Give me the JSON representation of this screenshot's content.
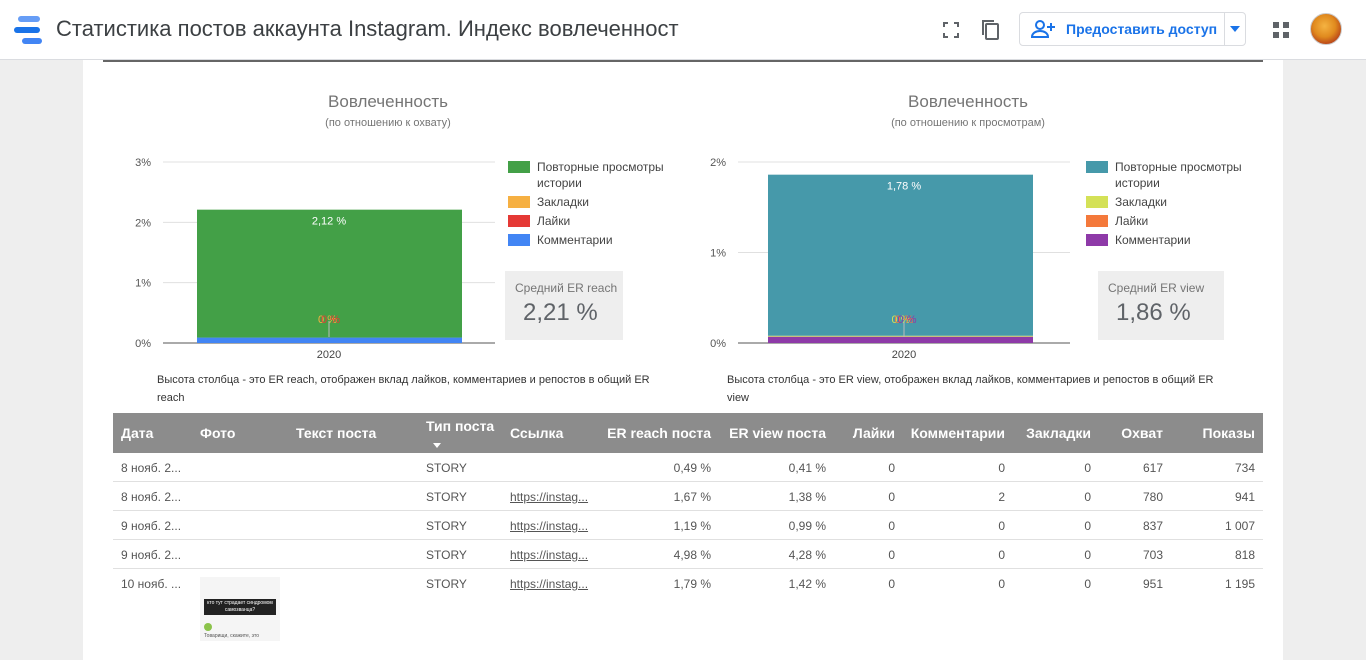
{
  "app": {
    "title": "Статистика постов аккаунта Instagram. Индекс вовлеченност",
    "share_label": "Предоставить доступ"
  },
  "icons": {
    "logo": "data-studio-logo-icon",
    "fullscreen": "fullscreen-icon",
    "copy": "copy-icon",
    "share": "add-person-icon",
    "apps": "apps-grid-icon"
  },
  "charts": {
    "left": {
      "title": "Вовлеченность",
      "subtitle": "(по отношению к охвату)",
      "caption": "Высота столбца - это ER reach, отображен вклад лайков, комментариев  и репостов в общий ER reach",
      "score_label": "Средний ER reach",
      "score_value": "2,21 %"
    },
    "right": {
      "title": "Вовлеченность",
      "subtitle": "(по отношению к просмотрам)",
      "caption": "Высота столбца - это ER view, отображен вклад лайков, комментариев и репостов в общий ER view",
      "score_label": "Средний ER view",
      "score_value": "1,86 %"
    }
  },
  "chart_data": [
    {
      "type": "bar",
      "stacked": true,
      "title": "Вовлеченность",
      "subtitle": "(по отношению к охвату)",
      "categories": [
        "2020"
      ],
      "ylim": [
        0,
        3
      ],
      "yticks": [
        "0%",
        "1%",
        "2%",
        "3%"
      ],
      "grid": true,
      "legend": "right",
      "series": [
        {
          "name": "Повторные просмотры истории",
          "values": [
            2.12
          ],
          "label": "2,12 %",
          "color": "#43a047"
        },
        {
          "name": "Закладки",
          "values": [
            0
          ],
          "label": "0 %",
          "color": "#f6b042"
        },
        {
          "name": "Лайки",
          "values": [
            0
          ],
          "label": "0 %",
          "color": "#e53935"
        },
        {
          "name": "Комментарии",
          "values": [
            0.09
          ],
          "label": "",
          "color": "#4285f4"
        }
      ]
    },
    {
      "type": "bar",
      "stacked": true,
      "title": "Вовлеченность",
      "subtitle": "(по отношению к просмотрам)",
      "categories": [
        "2020"
      ],
      "ylim": [
        0,
        2
      ],
      "yticks": [
        "0%",
        "1%",
        "2%"
      ],
      "grid": true,
      "legend": "right",
      "series": [
        {
          "name": "Повторные просмотры истории",
          "values": [
            1.78
          ],
          "label": "1,78 %",
          "color": "#4699aa"
        },
        {
          "name": "Закладки",
          "values": [
            0.01
          ],
          "label": "0 %",
          "color": "#d4e157"
        },
        {
          "name": "Лайки",
          "values": [
            0
          ],
          "label": "0 %",
          "color": "#f4793b"
        },
        {
          "name": "Комментарии",
          "values": [
            0.07
          ],
          "label": "0 %",
          "color": "#8e3aa8"
        }
      ]
    }
  ],
  "table": {
    "headers": [
      "Дата",
      "Фото",
      "Текст поста",
      "Тип поста",
      "Ссылка",
      "ER reach поста",
      "ER view поста",
      "Лайки",
      "Комментарии",
      "Закладки",
      "Охват",
      "Показы"
    ],
    "rows": [
      [
        "8 нояб. 2...",
        "",
        "",
        "STORY",
        "",
        "0,49 %",
        "0,41 %",
        "0",
        "0",
        "0",
        "617",
        "734"
      ],
      [
        "8 нояб. 2...",
        "",
        "",
        "STORY",
        "https://instag...",
        "1,67 %",
        "1,38 %",
        "0",
        "2",
        "0",
        "780",
        "941"
      ],
      [
        "9 нояб. 2...",
        "",
        "",
        "STORY",
        "https://instag...",
        "1,19 %",
        "0,99 %",
        "0",
        "0",
        "0",
        "837",
        "1 007"
      ],
      [
        "9 нояб. 2...",
        "",
        "",
        "STORY",
        "https://instag...",
        "4,98 %",
        "4,28 %",
        "0",
        "0",
        "0",
        "703",
        "818"
      ],
      [
        "10 нояб. ...",
        "",
        "",
        "STORY",
        "https://instag...",
        "1,79 %",
        "1,42 %",
        "0",
        "0",
        "0",
        "951",
        "1 195"
      ]
    ],
    "thumb_text": "кто тут страдает синдромом самозванца?",
    "thumb_caption": "Товарищи, скажите, это"
  }
}
